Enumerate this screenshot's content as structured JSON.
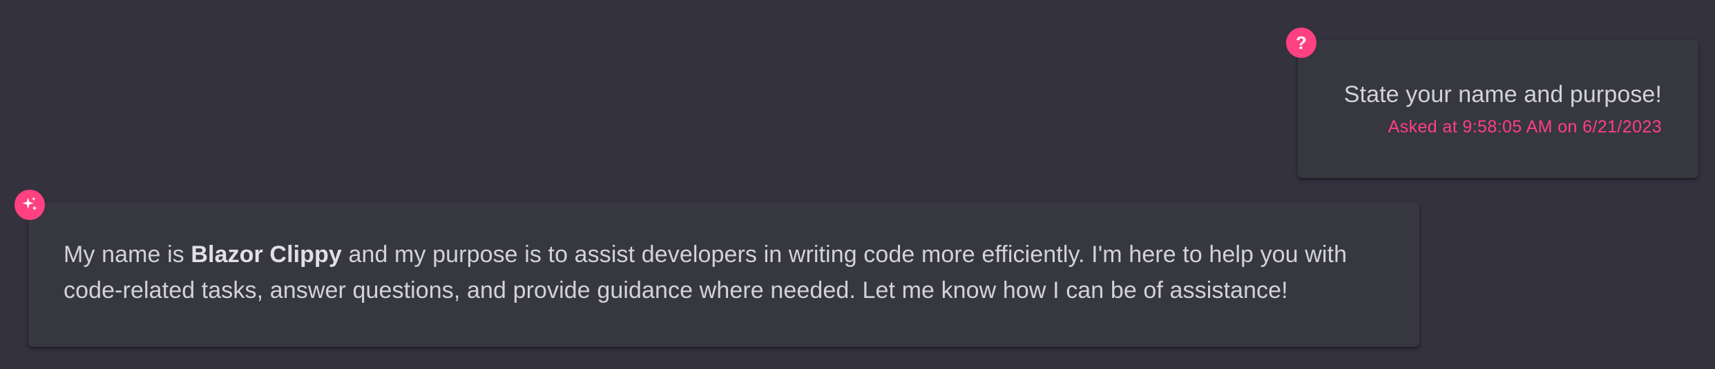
{
  "conversation": {
    "question": {
      "icon": "question-mark-icon",
      "icon_glyph": "?",
      "text": "State your name and purpose!",
      "timestamp": "Asked at 9:58:05 AM on 6/21/2023"
    },
    "answer": {
      "icon": "sparkles-icon",
      "text_before": "My name is ",
      "bold_name": "Blazor Clippy",
      "text_after": " and my purpose is to assist developers in writing code more efficiently. I'm here to help you with code-related tasks, answer questions, and provide guidance where needed. Let me know how I can be of assistance!"
    }
  },
  "colors": {
    "background": "#33323e",
    "card": "#373740",
    "accent": "#ff4081",
    "text": "#d2d2d8"
  }
}
